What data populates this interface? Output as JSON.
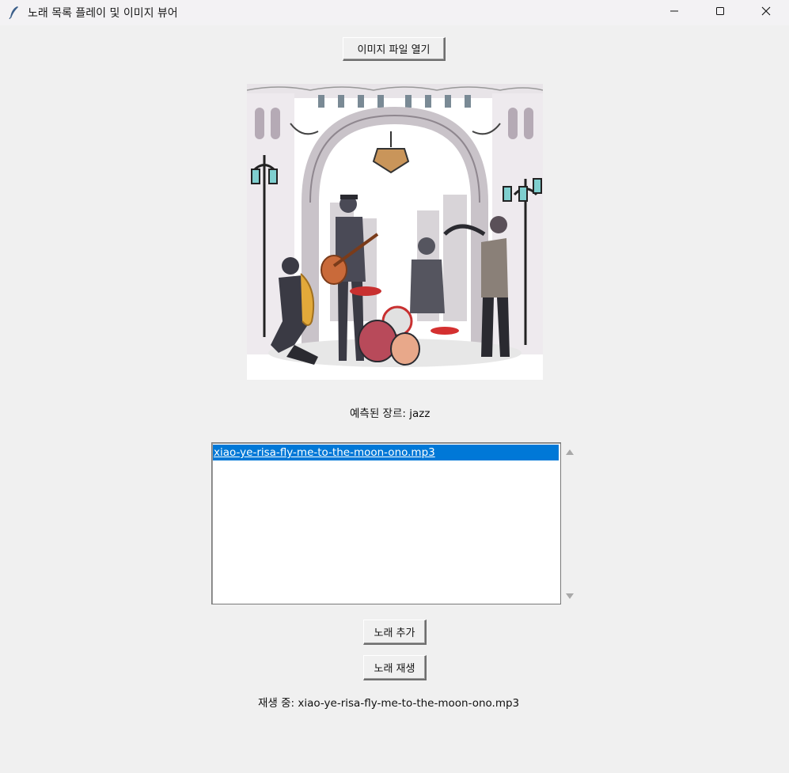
{
  "window": {
    "title": "노래 목록 플레이 및 이미지 뷰어",
    "controls": [
      "minimize",
      "maximize",
      "close"
    ]
  },
  "toolbar": {
    "open_image_label": "이미지 파일 열기"
  },
  "image": {
    "description_icon": "jazz-band-image"
  },
  "genre": {
    "text": "예측된 장르: jazz"
  },
  "playlist": {
    "items": [
      "xiao-ye-risa-fly-me-to-the-moon-ono.mp3"
    ],
    "selected_index": 0
  },
  "actions": {
    "add_song_label": "노래 추가",
    "play_song_label": "노래 재생"
  },
  "status": {
    "now_playing": "재생 중: xiao-ye-risa-fly-me-to-the-moon-ono.mp3"
  },
  "colors": {
    "selection": "#0078d7",
    "background": "#f0f0f0"
  }
}
